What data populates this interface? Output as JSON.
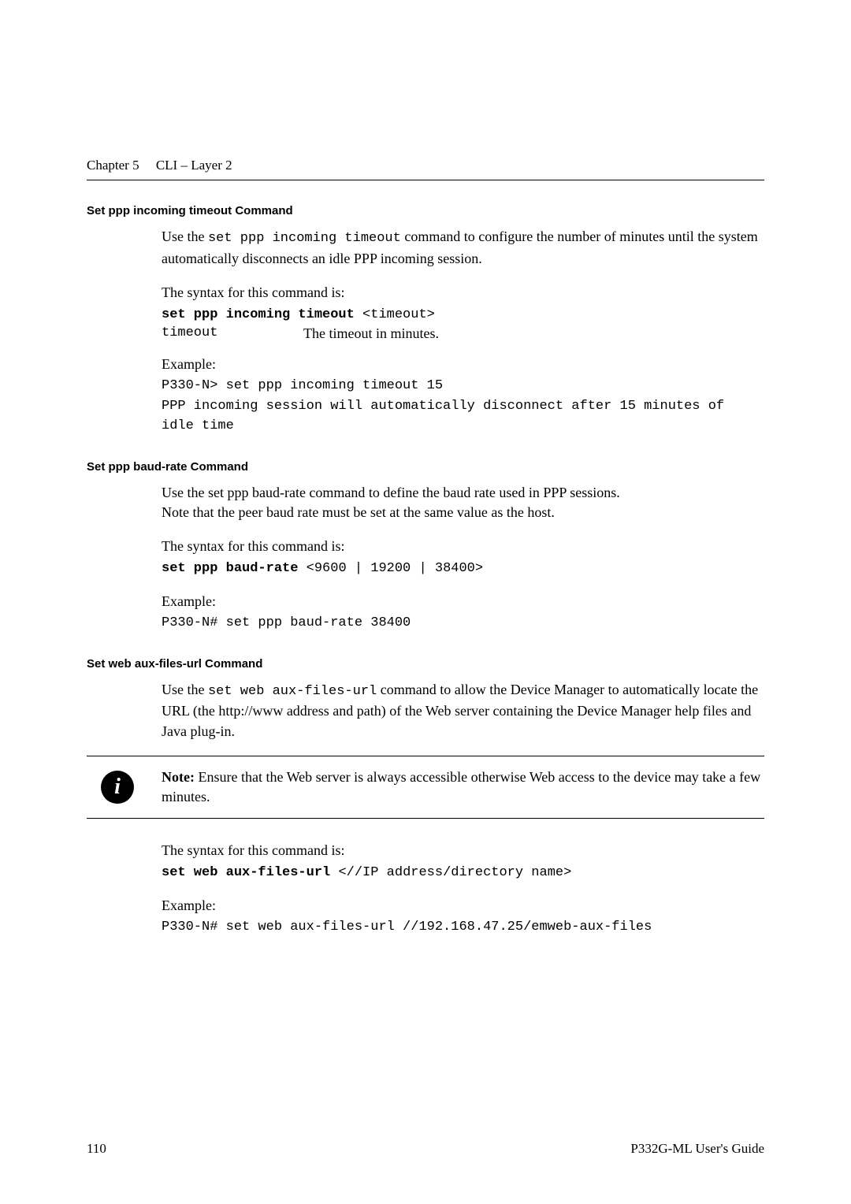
{
  "header": {
    "chapter": "Chapter 5",
    "title": "CLI – Layer 2"
  },
  "sections": {
    "s1": {
      "heading": "Set ppp incoming timeout Command",
      "intro_prefix": "Use the ",
      "intro_cmd": "set ppp incoming timeout",
      "intro_suffix": " command to configure the number of minutes until the system automatically disconnects an idle PPP incoming session.",
      "syntax_label": "The syntax for this command is:",
      "syntax_bold": "set ppp incoming timeout",
      "syntax_rest": " <timeout>",
      "param_name": "timeout",
      "param_desc": "The timeout in minutes.",
      "example_label": "Example:",
      "example_line1": "P330-N> set ppp incoming timeout 15",
      "example_line2": "PPP incoming session will automatically disconnect after 15 minutes of idle time"
    },
    "s2": {
      "heading": "Set ppp baud-rate Command",
      "para1": "Use the set ppp baud-rate command to define the baud rate used in PPP sessions.",
      "para2": "Note that the peer baud rate must be set at the same value as the host.",
      "syntax_label": "The syntax for this command is:",
      "syntax_bold": "set ppp baud-rate",
      "syntax_rest": " <9600 | 19200 | 38400>",
      "example_label": "Example:",
      "example_line1": "P330-N# set ppp baud-rate 38400"
    },
    "s3": {
      "heading": "Set web aux-files-url Command",
      "intro_prefix": "Use the ",
      "intro_cmd": "set web aux-files-url",
      "intro_suffix": " command to allow the Device Manager to automatically locate the URL (the http://www address and path) of the Web server containing the Device Manager help files and Java plug-in.",
      "note_bold": "Note:",
      "note_text": "  Ensure that the Web server is always accessible otherwise Web access to the device may take a few minutes.",
      "syntax_label": "The syntax for this command is:",
      "syntax_bold": "set web aux-files-url",
      "syntax_rest": " <//IP address/directory name>",
      "example_label": "Example:",
      "example_line1": "P330-N# set web aux-files-url //192.168.47.25/emweb-aux-files"
    }
  },
  "footer": {
    "page": "110",
    "guide": "P332G-ML User's Guide"
  }
}
